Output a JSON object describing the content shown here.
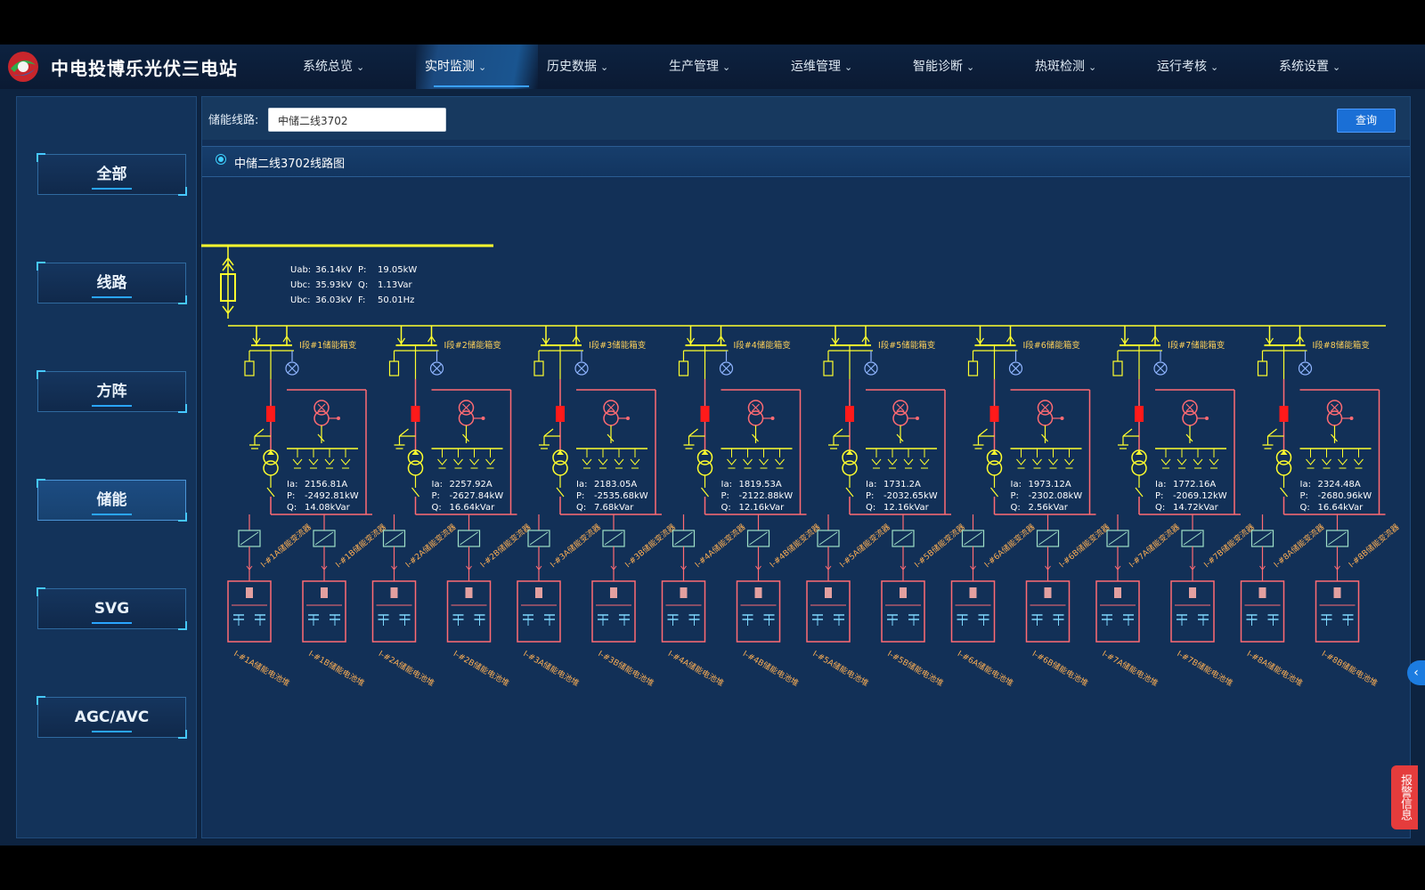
{
  "app": {
    "title": "中电投博乐光伏三电站"
  },
  "nav": [
    {
      "label": "系统总览"
    },
    {
      "label": "实时监测",
      "active": true
    },
    {
      "label": "历史数据"
    },
    {
      "label": "生产管理"
    },
    {
      "label": "运维管理"
    },
    {
      "label": "智能诊断"
    },
    {
      "label": "热斑检测"
    },
    {
      "label": "运行考核"
    },
    {
      "label": "系统设置"
    }
  ],
  "sidebar": [
    {
      "label": "全部"
    },
    {
      "label": "线路"
    },
    {
      "label": "方阵"
    },
    {
      "label": "储能",
      "active": true
    },
    {
      "label": "SVG"
    },
    {
      "label": "AGC/AVC"
    }
  ],
  "filter": {
    "label": "储能线路:",
    "selected": "中储二线3702",
    "query_label": "查询"
  },
  "section": {
    "title": "中储二线3702线路图"
  },
  "main_meter": [
    {
      "k": "Uab:",
      "v": "36.14kV"
    },
    {
      "k": "P:",
      "v": "19.05kW"
    },
    {
      "k": "Ubc:",
      "v": "35.93kV"
    },
    {
      "k": "Q:",
      "v": "1.13Var"
    },
    {
      "k": "Ubc:",
      "v": "36.03kV"
    },
    {
      "k": "F:",
      "v": "50.01Hz"
    }
  ],
  "units": [
    {
      "name": "I段#1储能箱变",
      "ia": "2156.81A",
      "p": "-2492.81kW",
      "q": "14.08kVar",
      "pcs": [
        "I-#1A储能变流器",
        "I-#1B储能变流器"
      ],
      "bat": [
        "I-#1A储能电池堆",
        "I-#1B储能电池堆"
      ]
    },
    {
      "name": "I段#2储能箱变",
      "ia": "2257.92A",
      "p": "-2627.84kW",
      "q": "16.64kVar",
      "pcs": [
        "I-#2A储能变流器",
        "I-#2B储能变流器"
      ],
      "bat": [
        "I-#2A储能电池堆",
        "I-#2B储能电池堆"
      ]
    },
    {
      "name": "I段#3储能箱变",
      "ia": "2183.05A",
      "p": "-2535.68kW",
      "q": "7.68kVar",
      "pcs": [
        "I-#3A储能变流器",
        "I-#3B储能变流器"
      ],
      "bat": [
        "I-#3A储能电池堆",
        "I-#3B储能电池堆"
      ]
    },
    {
      "name": "I段#4储能箱变",
      "ia": "1819.53A",
      "p": "-2122.88kW",
      "q": "12.16kVar",
      "pcs": [
        "I-#4A储能变流器",
        "I-#4B储能变流器"
      ],
      "bat": [
        "I-#4A储能电池堆",
        "I-#4B储能电池堆"
      ]
    },
    {
      "name": "I段#5储能箱变",
      "ia": "1731.2A",
      "p": "-2032.65kW",
      "q": "12.16kVar",
      "pcs": [
        "I-#5A储能变流器",
        "I-#5B储能变流器"
      ],
      "bat": [
        "I-#5A储能电池堆",
        "I-#5B储能电池堆"
      ]
    },
    {
      "name": "I段#6储能箱变",
      "ia": "1973.12A",
      "p": "-2302.08kW",
      "q": "2.56kVar",
      "pcs": [
        "I-#6A储能变流器",
        "I-#6B储能变流器"
      ],
      "bat": [
        "I-#6A储能电池堆",
        "I-#6B储能电池堆"
      ]
    },
    {
      "name": "I段#7储能箱变",
      "ia": "1772.16A",
      "p": "-2069.12kW",
      "q": "14.72kVar",
      "pcs": [
        "I-#7A储能变流器",
        "I-#7B储能变流器"
      ],
      "bat": [
        "I-#7A储能电池堆",
        "I-#7B储能电池堆"
      ]
    },
    {
      "name": "I段#8储能箱变",
      "ia": "2324.48A",
      "p": "-2680.96kW",
      "q": "16.64kVar",
      "pcs": [
        "I-#8A储能变流器",
        "I-#8B储能变流器"
      ],
      "bat": [
        "I-#8A储能电池堆",
        "I-#8B储能电池堆"
      ]
    }
  ],
  "meter_labels": {
    "ia": "Ia:",
    "p": "P:",
    "q": "Q:"
  },
  "alarm": {
    "label": "报警信息"
  },
  "collapse": {
    "label": "‹"
  },
  "colors": {
    "bus": "#ffff2e",
    "circuit": "#ff6b73",
    "breaker": "#ff1a1a",
    "accent": "#2aa5ff"
  }
}
